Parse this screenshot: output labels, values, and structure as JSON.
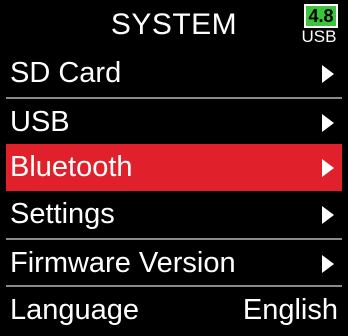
{
  "header": {
    "title": "SYSTEM",
    "battery": {
      "level": "4.8",
      "source": "USB",
      "color": "#3cc43c"
    }
  },
  "menu": {
    "items": [
      {
        "label": "SD Card",
        "value": "",
        "has_arrow": true,
        "selected": false
      },
      {
        "label": "USB",
        "value": "",
        "has_arrow": true,
        "selected": false
      },
      {
        "label": "Bluetooth",
        "value": "",
        "has_arrow": true,
        "selected": true
      },
      {
        "label": "Settings",
        "value": "",
        "has_arrow": true,
        "selected": false
      },
      {
        "label": "Firmware Version",
        "value": "",
        "has_arrow": true,
        "selected": false
      },
      {
        "label": "Language",
        "value": "English",
        "has_arrow": false,
        "selected": false
      }
    ],
    "selected_color": "#e0202a"
  }
}
